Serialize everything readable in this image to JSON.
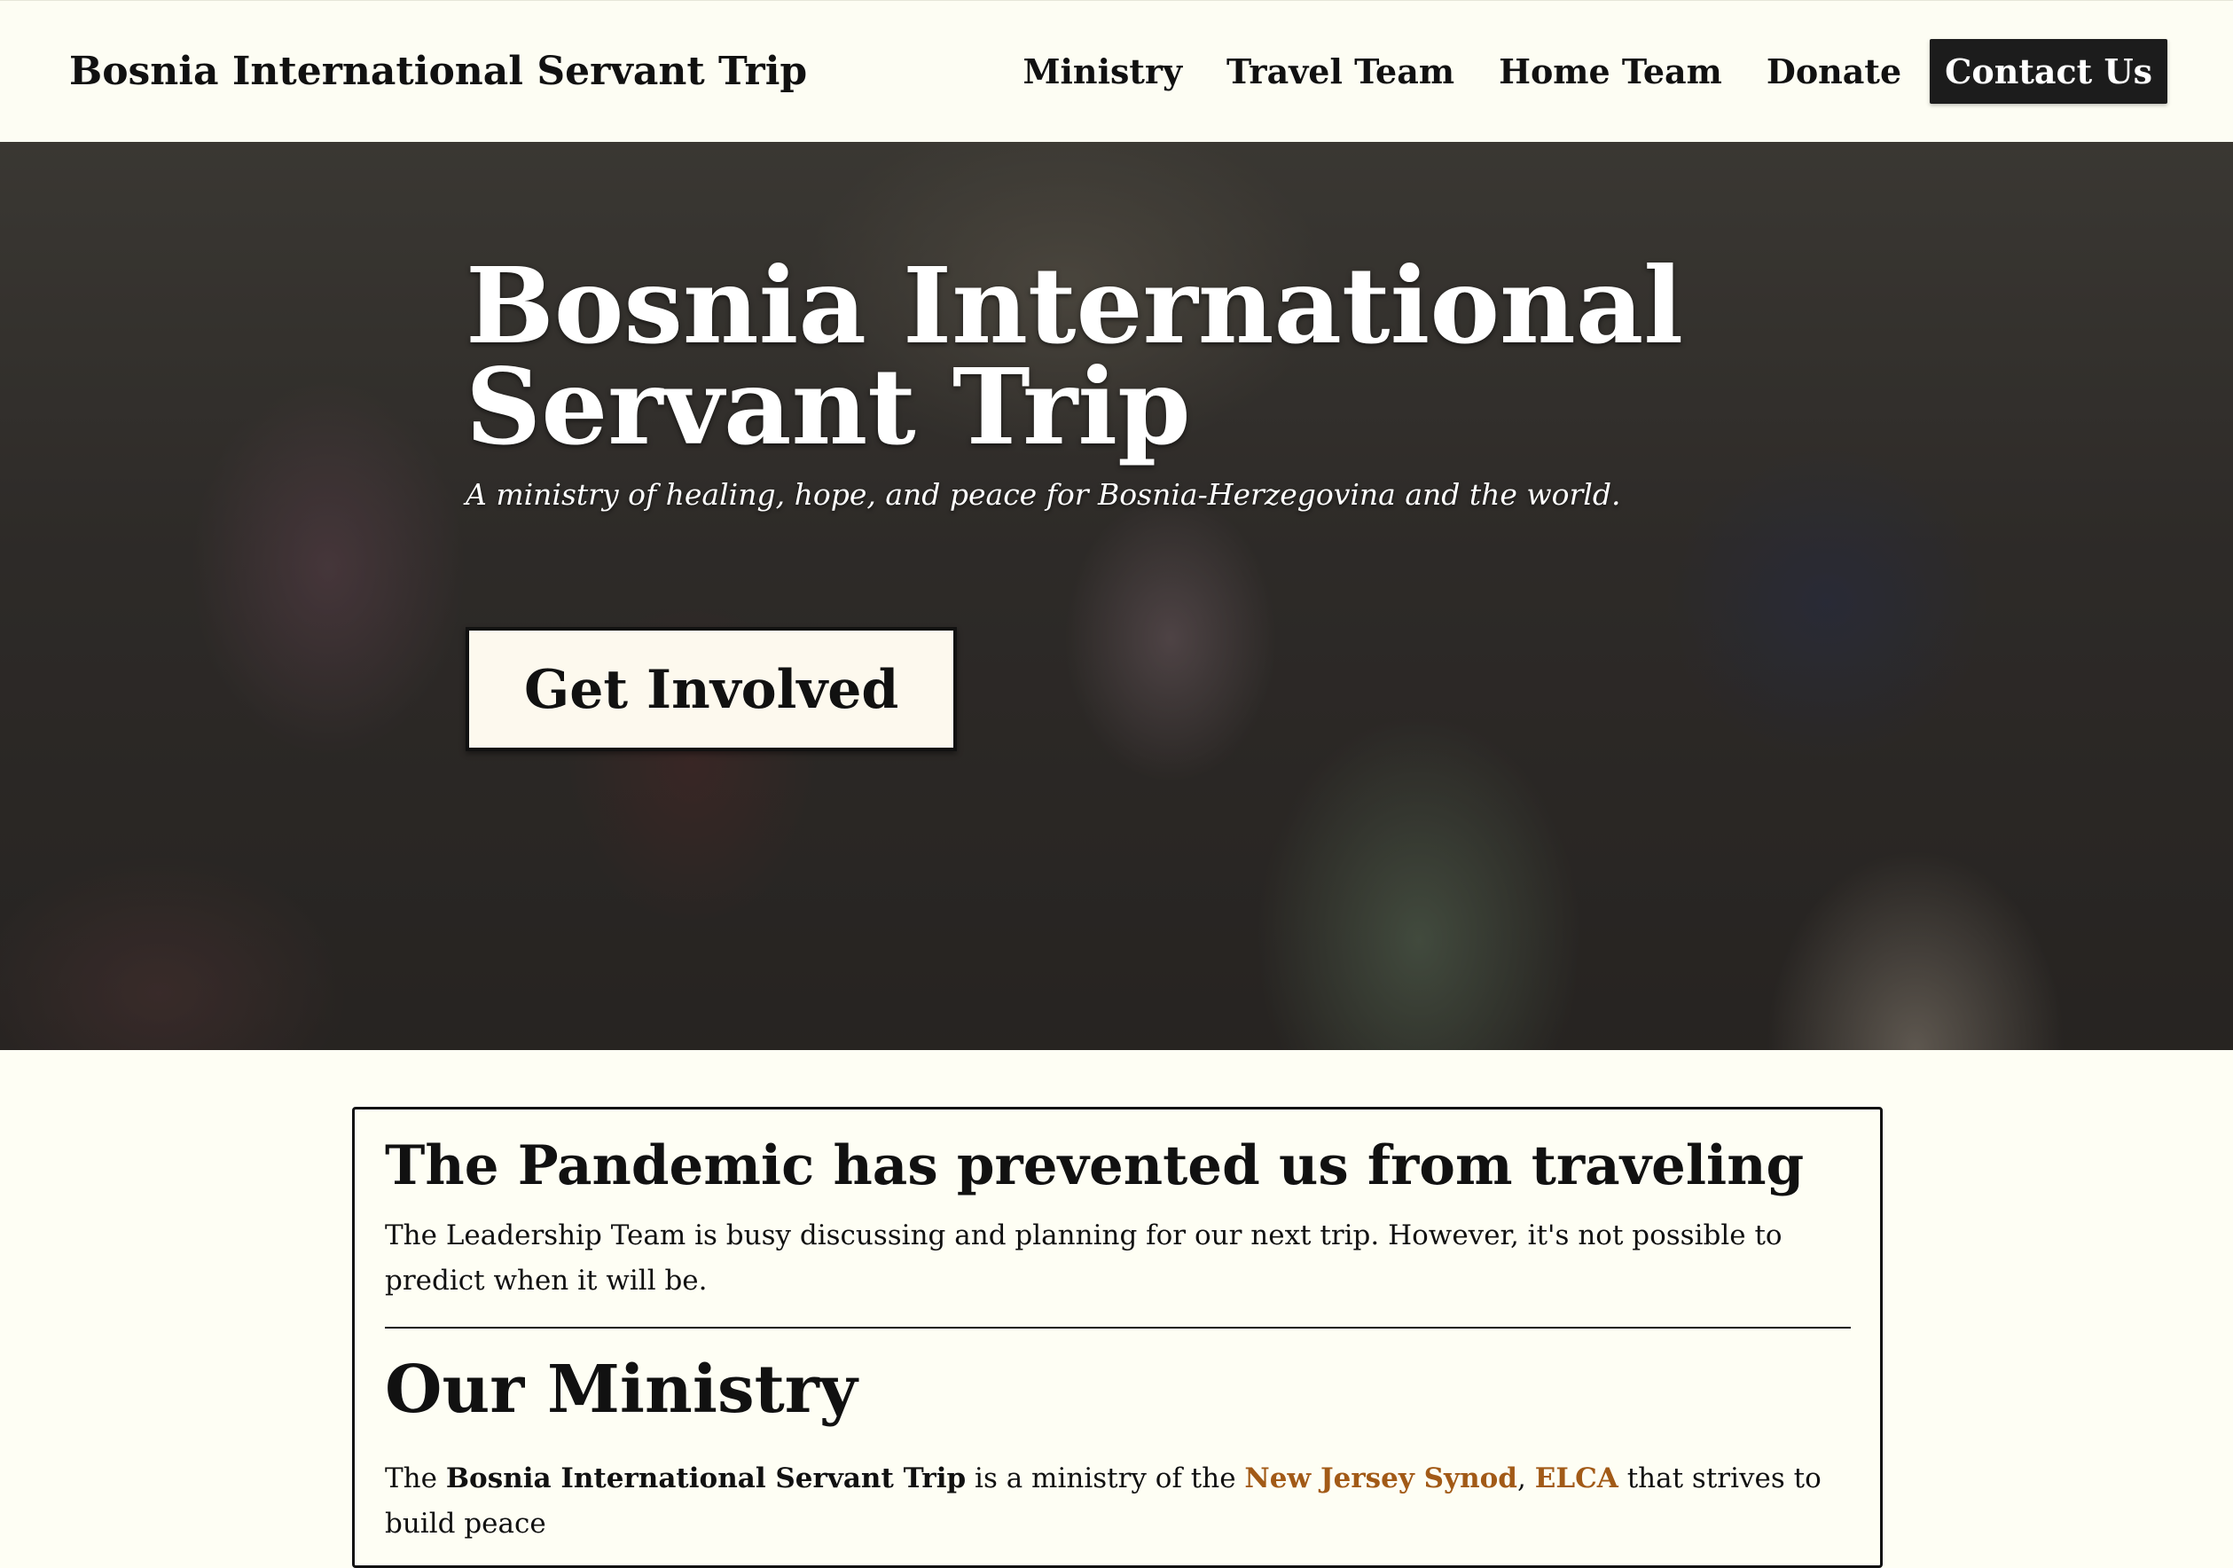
{
  "header": {
    "brand": "Bosnia International Servant Trip",
    "nav": {
      "ministry": "Ministry",
      "travel_team": "Travel Team",
      "home_team": "Home Team",
      "donate": "Donate",
      "contact": "Contact Us"
    }
  },
  "hero": {
    "title_line1": "Bosnia International",
    "title_line2": "Servant Trip",
    "subtitle": "A ministry of healing, hope, and peace for Bosnia-Herzegovina and the world.",
    "cta_label": "Get Involved"
  },
  "notice": {
    "heading": "The Pandemic has prevented us from traveling",
    "body": "The Leadership Team is busy discussing and planning for our next trip. However, it's not possible to predict when it will be."
  },
  "ministry": {
    "heading": "Our Ministry",
    "text_the": "The",
    "program_name": "Bosnia International Servant Trip",
    "text_middle": "is a ministry of the",
    "link_synod": "New Jersey Synod",
    "comma": ",",
    "link_elca": "ELCA",
    "text_end": "that strives to build peace"
  },
  "colors": {
    "link": "#a25a17",
    "contact_button_bg": "#1c1c1c",
    "page_background": "#fefef4"
  }
}
